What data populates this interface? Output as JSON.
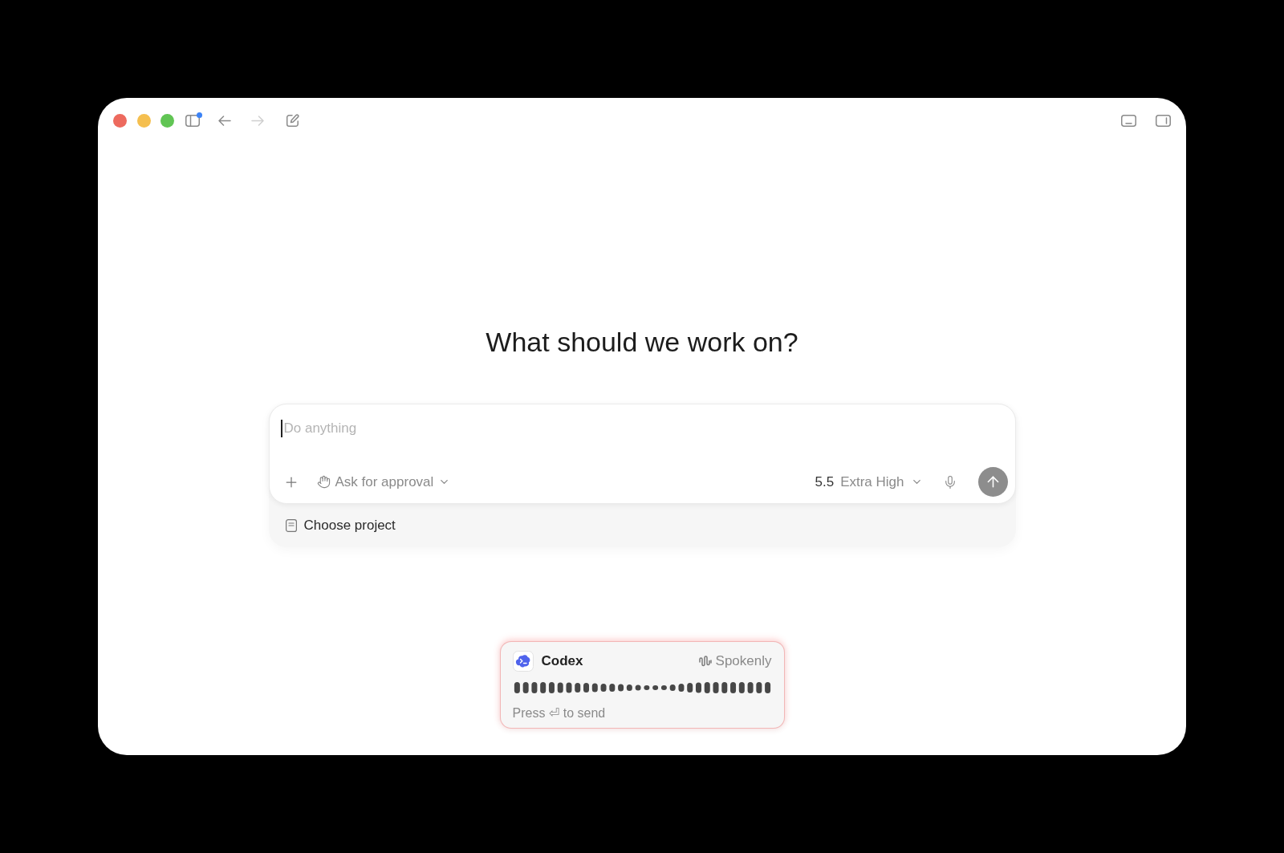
{
  "toolbar": {
    "sidebar_badge": true,
    "back": {
      "disabled": false
    },
    "forward": {
      "disabled": true
    }
  },
  "heading": "What should we work on?",
  "composer": {
    "placeholder": "Do anything",
    "focused": true,
    "approval": "Ask for approval",
    "model": {
      "version": "5.5",
      "effort": "Extra High"
    },
    "send": {
      "disabled": true
    }
  },
  "project": "Choose project",
  "dictation": {
    "app": "Codex",
    "service": "Spokenly",
    "hint": "Press ⏎ to send"
  }
}
